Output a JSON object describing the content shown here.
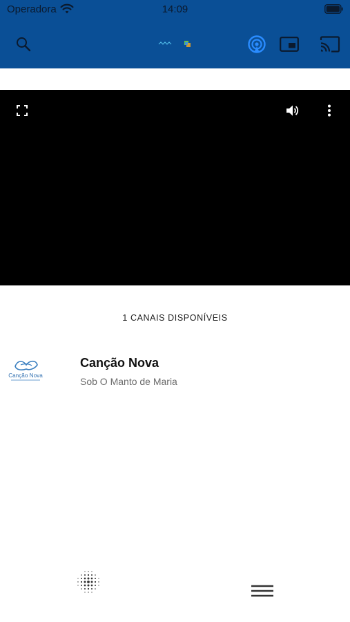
{
  "status_bar": {
    "carrier": "Operadora",
    "time": "14:09"
  },
  "colors": {
    "header_bg": "#0a4f96",
    "header_icons": "#0b1a2e",
    "live_icon": "#2a8cff",
    "player_bg": "#000000"
  },
  "icons": {
    "search": "search-icon",
    "live": "live-broadcast-icon",
    "pip": "picture-in-picture-icon",
    "cast": "cast-icon",
    "fullscreen": "fullscreen-icon",
    "volume": "volume-icon",
    "more": "more-vertical-icon",
    "dots": "dots-grid-icon",
    "menu": "hamburger-menu-icon"
  },
  "channels": {
    "count_label": "1 CANAIS DISPONÍVEIS",
    "items": [
      {
        "name": "Canção Nova",
        "program": "Sob O Manto de Maria",
        "logo_text": "Canção Nova"
      }
    ]
  }
}
